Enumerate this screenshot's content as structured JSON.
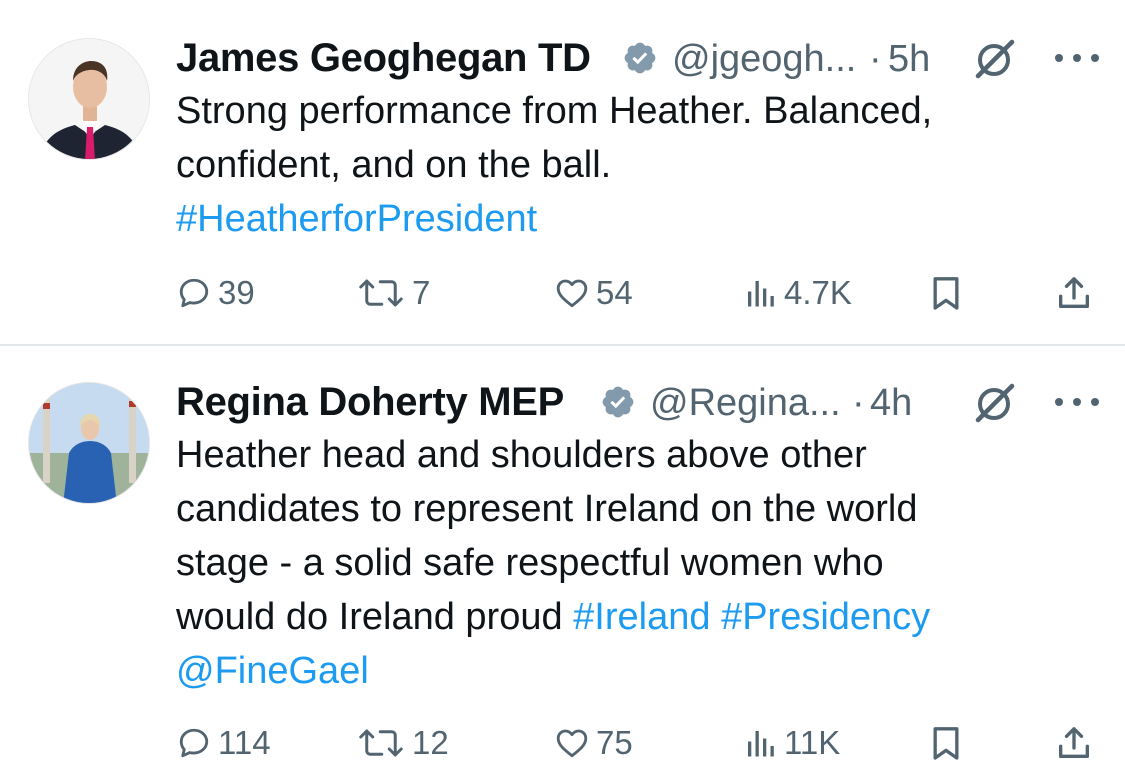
{
  "tweets": [
    {
      "name": "James Geoghegan TD",
      "handle": "@jgeogh...",
      "dot": "·",
      "time": "5h",
      "lines": [
        [
          {
            "t": "Strong performance from Heather. Balanced,",
            "link": false
          }
        ],
        [
          {
            "t": "confident, and on the ball.",
            "link": false
          }
        ],
        [
          {
            "t": "#HeatherforPresident",
            "link": true
          }
        ]
      ],
      "stats": {
        "replies": "39",
        "reposts": "7",
        "likes": "54",
        "views": "4.7K"
      },
      "avatar_icon": "man-in-suit-avatar"
    },
    {
      "name": "Regina Doherty MEP",
      "handle": "@Regina...",
      "dot": "·",
      "time": "4h",
      "lines": [
        [
          {
            "t": "Heather head and shoulders above other",
            "link": false
          }
        ],
        [
          {
            "t": "candidates to represent Ireland on the world",
            "link": false
          }
        ],
        [
          {
            "t": "stage - a solid safe respectful women who",
            "link": false
          }
        ],
        [
          {
            "t": "would do Ireland proud ",
            "link": false
          },
          {
            "t": "#Ireland",
            "link": true
          },
          {
            "t": " ",
            "link": false
          },
          {
            "t": "#Presidency",
            "link": true
          }
        ],
        [
          {
            "t": "@FineGael",
            "link": true
          }
        ]
      ],
      "stats": {
        "replies": "114",
        "reposts": "12",
        "likes": "75",
        "views": "11K"
      },
      "avatar_icon": "woman-in-blue-coat-avatar"
    }
  ],
  "colors": {
    "text": "#0f1419",
    "secondary": "#536471",
    "link": "#1d9bf0",
    "divider": "#e4e7ea"
  }
}
